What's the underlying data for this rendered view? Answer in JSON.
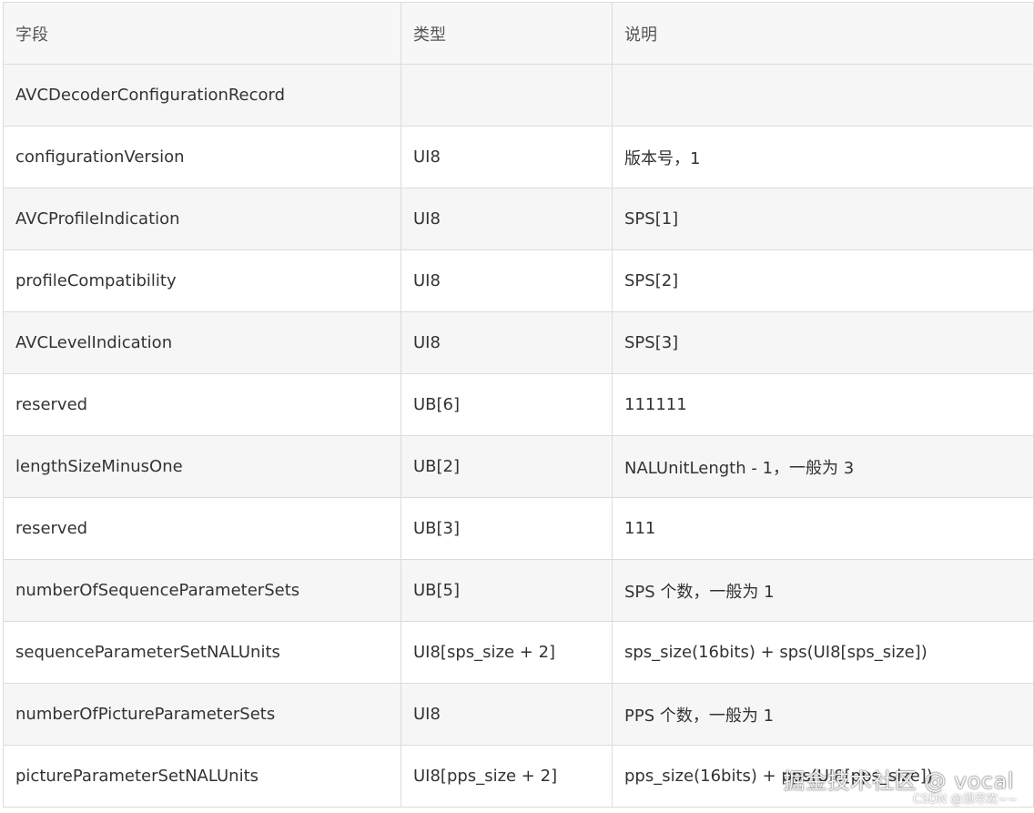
{
  "table": {
    "headers": [
      "字段",
      "类型",
      "说明"
    ],
    "rows": [
      [
        "AVCDecoderConfigurationRecord",
        "",
        ""
      ],
      [
        "configurationVersion",
        "UI8",
        "版本号，1"
      ],
      [
        "AVCProfileIndication",
        "UI8",
        "SPS[1]"
      ],
      [
        "profileCompatibility",
        "UI8",
        "SPS[2]"
      ],
      [
        "AVCLevelIndication",
        "UI8",
        "SPS[3]"
      ],
      [
        "reserved",
        "UB[6]",
        "111111"
      ],
      [
        "lengthSizeMinusOne",
        "UB[2]",
        "NALUnitLength - 1，一般为 3"
      ],
      [
        "reserved",
        "UB[3]",
        "111"
      ],
      [
        "numberOfSequenceParameterSets",
        "UB[5]",
        "SPS 个数，一般为 1"
      ],
      [
        "sequenceParameterSetNALUnits",
        "UI8[sps_size + 2]",
        "sps_size(16bits) + sps(UI8[sps_size])"
      ],
      [
        "numberOfPictureParameterSets",
        "UI8",
        "PPS 个数，一般为 1"
      ],
      [
        "pictureParameterSetNALUnits",
        "UI8[pps_size + 2]",
        "pps_size(16bits) + pps(UI8[pps_size])"
      ]
    ]
  },
  "watermark": {
    "main": "掘金技术社区 @ vocal",
    "sub": "CSDN @须尽欢~~"
  }
}
